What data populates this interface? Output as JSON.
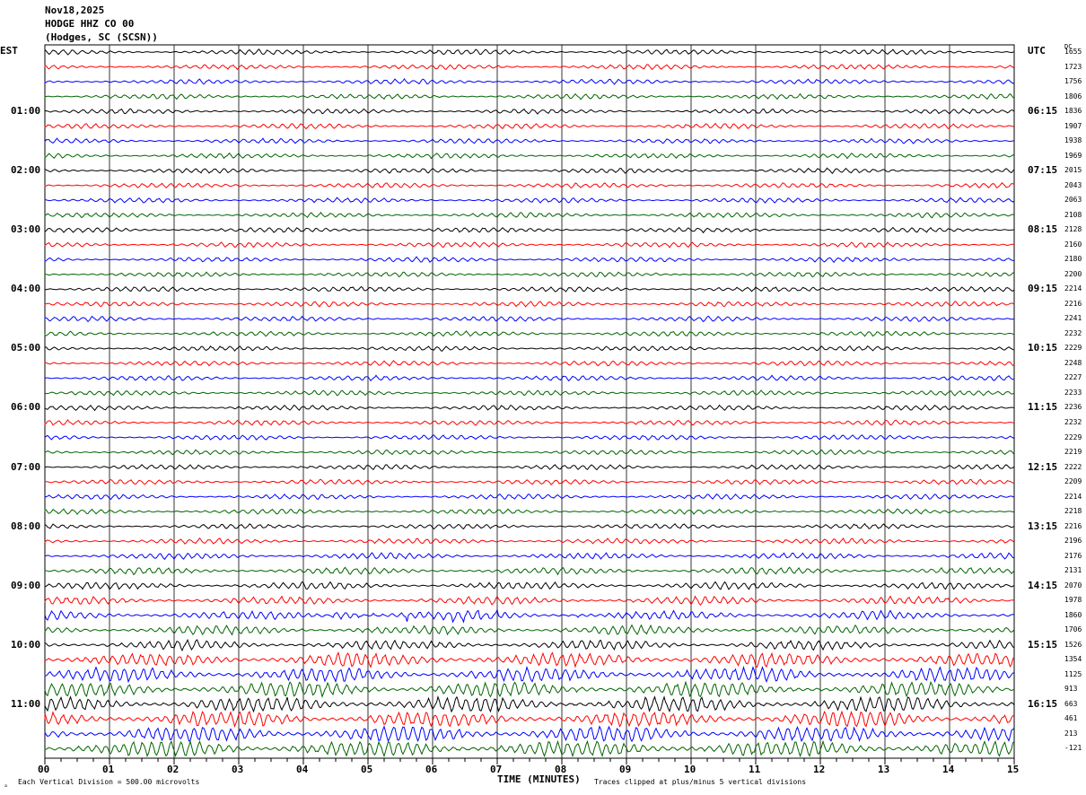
{
  "header": {
    "date": "Nov18,2025",
    "station": "HODGE HHZ CO 00",
    "location": "(Hodges, SC (SCSN))"
  },
  "chart_data": {
    "type": "line",
    "subtype": "helicorder",
    "left_axis_title": "EST",
    "right_axis_title": "UTC",
    "dc_title": "DC",
    "est_labels": [
      "01:00",
      "02:00",
      "03:00",
      "04:00",
      "05:00",
      "06:00",
      "07:00",
      "08:00",
      "09:00",
      "10:00",
      "11:00"
    ],
    "utc_labels": [
      "06:15",
      "07:15",
      "08:15",
      "09:15",
      "10:15",
      "11:15",
      "12:15",
      "13:15",
      "14:15",
      "15:15",
      "16:15"
    ],
    "dc_values": [
      "1655",
      "1723",
      "1756",
      "1806",
      "1836",
      "1907",
      "1938",
      "1969",
      "2015",
      "2043",
      "2063",
      "2108",
      "2128",
      "2160",
      "2180",
      "2200",
      "2214",
      "2216",
      "2241",
      "2232",
      "2229",
      "2248",
      "2227",
      "2233",
      "2236",
      "2232",
      "2229",
      "2219",
      "2222",
      "2209",
      "2214",
      "2218",
      "2216",
      "2196",
      "2176",
      "2131",
      "2070",
      "1978",
      "1860",
      "1706",
      "1526",
      "1354",
      "1125",
      "913",
      "663",
      "461",
      "213",
      "-121"
    ],
    "x_ticks": [
      "00",
      "01",
      "02",
      "03",
      "04",
      "05",
      "06",
      "07",
      "08",
      "09",
      "10",
      "11",
      "12",
      "13",
      "14",
      "15"
    ],
    "xlabel": "TIME (MINUTES)",
    "xlim": [
      0,
      15
    ],
    "grid": true,
    "trace_colors": [
      "#000000",
      "#ff0000",
      "#0000ff",
      "#006400"
    ]
  },
  "footer": {
    "scale": "Each Vertical Division =  500.00 microvolts",
    "clip": "Traces clipped at plus/minus 5 vertical divisions"
  }
}
